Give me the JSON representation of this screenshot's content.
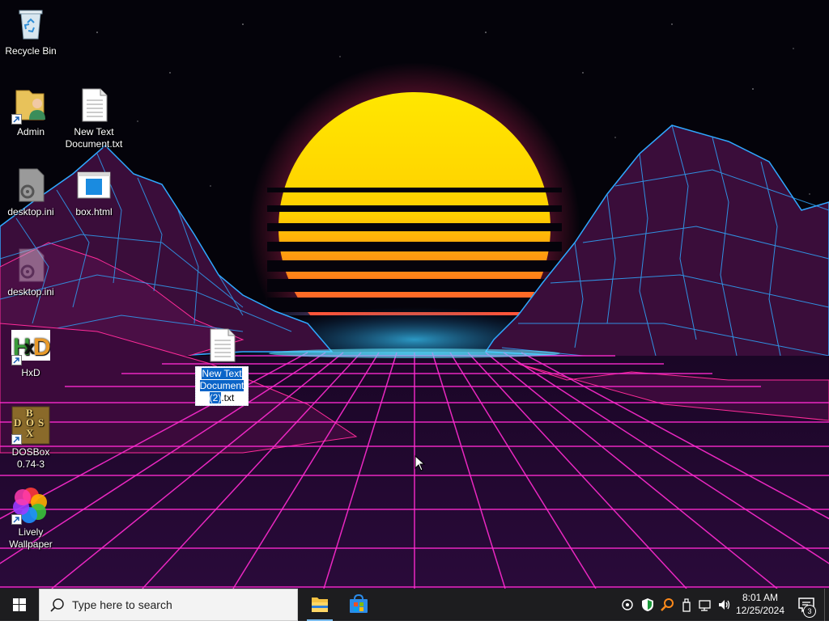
{
  "desktop": {
    "icons": [
      {
        "label": "Recycle Bin"
      },
      {
        "label": "Admin"
      },
      {
        "label": "New Text Document.txt"
      },
      {
        "label": "desktop.ini"
      },
      {
        "label": "box.html"
      },
      {
        "label": "desktop.ini"
      },
      {
        "label": "HxD"
      },
      {
        "label": "DOSBox 0.74-3"
      },
      {
        "label": "Lively Wallpaper"
      }
    ],
    "renaming_icon": {
      "label_selected": "New Text Document (2)",
      "label_ext": ".txt"
    }
  },
  "taskbar": {
    "search_placeholder": "Type here to search",
    "apps": [
      "File Explorer",
      "Microsoft Store"
    ],
    "tray_icons": [
      "network-icon",
      "defender-icon",
      "search-tool-icon",
      "usb-icon",
      "wifi-icon",
      "volume-icon"
    ],
    "clock_time": "8:01 AM",
    "clock_date": "12/25/2024",
    "notification_count": "3"
  },
  "colors": {
    "taskbar_bg": "#1d1d1f",
    "selection": "#0a64c8",
    "accent": "#76b9ed"
  }
}
